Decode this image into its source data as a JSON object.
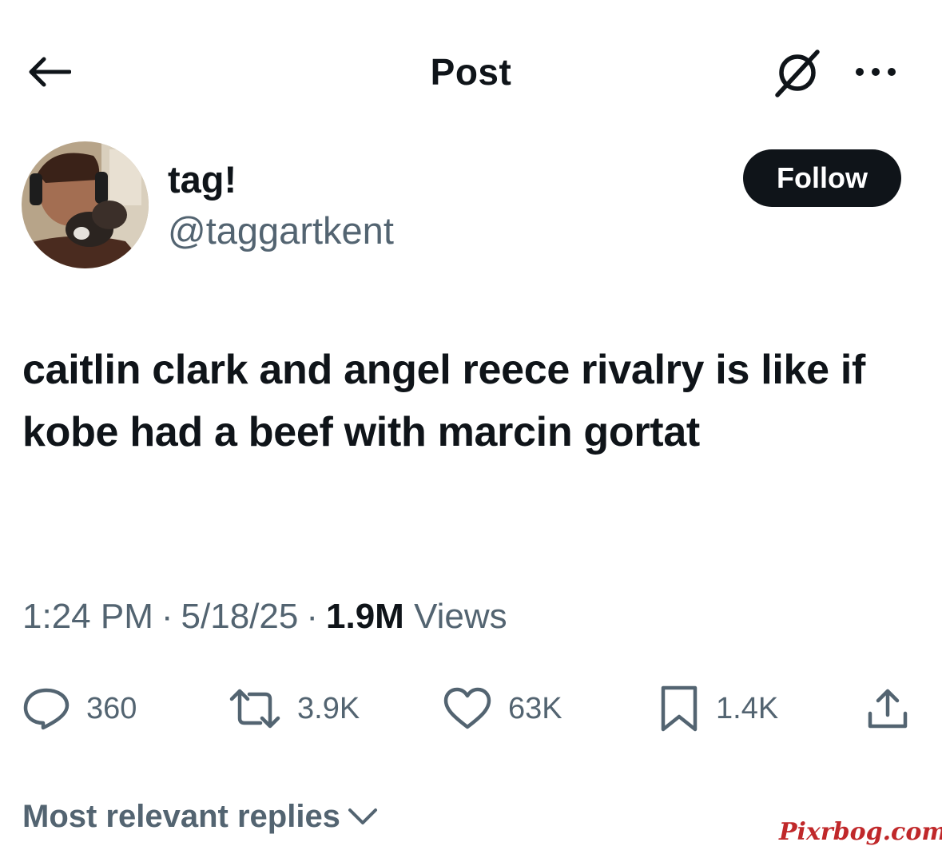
{
  "header": {
    "title": "Post",
    "back_icon": "arrow-left-icon",
    "grok_icon": "grok-icon",
    "more_icon": "more-dots-icon"
  },
  "author": {
    "display_name": "tag!",
    "handle": "@taggartkent",
    "follow_label": "Follow"
  },
  "tweet": {
    "text": "caitlin clark and angel reece rivalry is like if kobe had a beef with marcin gortat"
  },
  "meta": {
    "time": "1:24 PM",
    "sep1": "·",
    "date": "5/18/25",
    "sep2": "·",
    "views_count": "1.9M",
    "views_label": "Views"
  },
  "actions": {
    "replies": "360",
    "reposts": "3.9K",
    "likes": "63K",
    "bookmarks": "1.4K"
  },
  "replies_sort": {
    "label": "Most relevant replies"
  },
  "watermark": "Pixrbog.com",
  "colors": {
    "text": "#0f1419",
    "secondary": "#536471",
    "follow_bg": "#0f1419",
    "watermark": "#c0282a"
  }
}
